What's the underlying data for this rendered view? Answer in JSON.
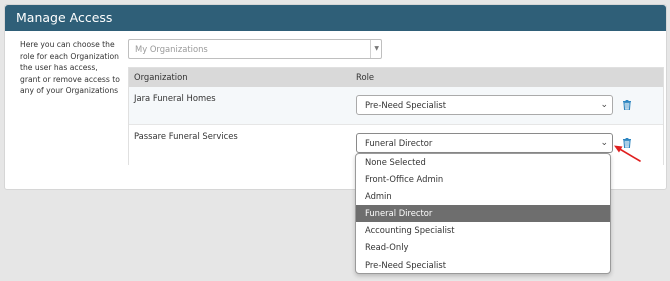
{
  "panel": {
    "title": "Manage Access",
    "help_text": "Here you can choose the role for each Organization the user has access, grant or remove access to any of your Organizations"
  },
  "org_select": {
    "placeholder": "My Organizations"
  },
  "table": {
    "headers": {
      "organization": "Organization",
      "role": "Role"
    },
    "rows": [
      {
        "organization": "Jara Funeral Homes",
        "role": "Pre-Need Specialist"
      },
      {
        "organization": "Passare Funeral Services",
        "role": "Funeral Director"
      }
    ]
  },
  "role_dropdown": {
    "options": [
      "None Selected",
      "Front-Office Admin",
      "Admin",
      "Funeral Director",
      "Accounting Specialist",
      "Read-Only",
      "Pre-Need Specialist"
    ],
    "selected": "Funeral Director"
  },
  "colors": {
    "header_bg": "#2f5f78",
    "trash_icon": "#2e86c1",
    "annotation_arrow": "#e02020",
    "selected_option_bg": "#6e6e6e"
  },
  "icons": {
    "trash": "trash-icon",
    "chevron": "chevron-down-icon",
    "caret": "caret-down-icon",
    "arrow": "red-arrow"
  }
}
